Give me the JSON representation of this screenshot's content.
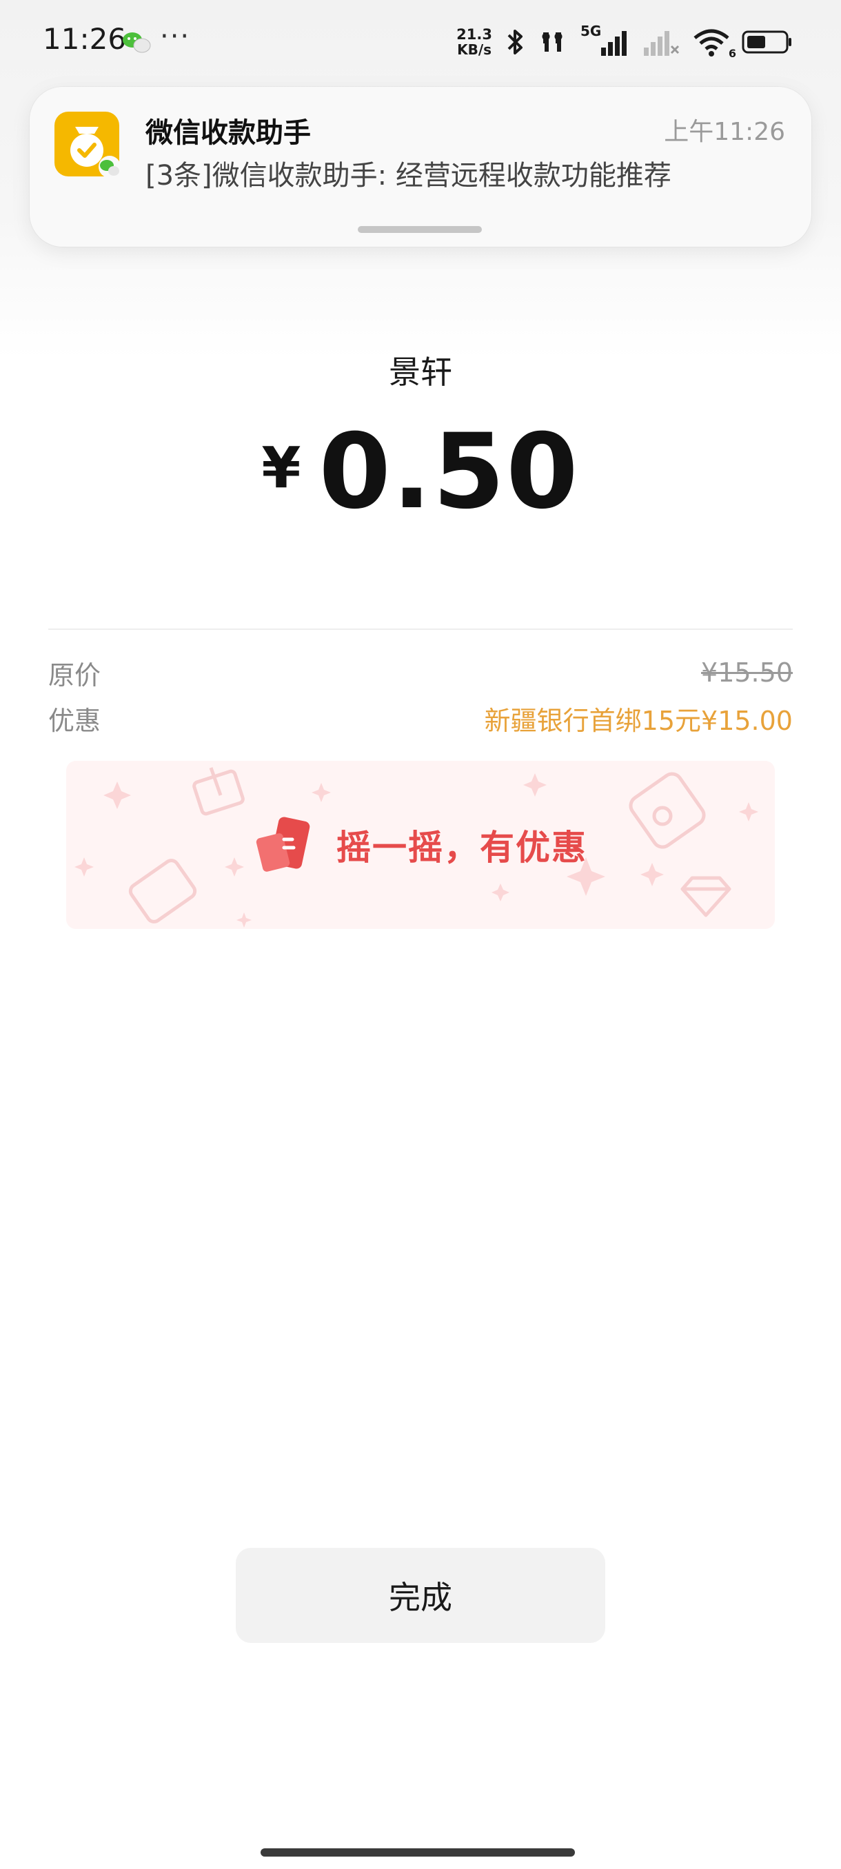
{
  "status_bar": {
    "time": "11:26",
    "more": "···",
    "net_speed_value": "21.3",
    "net_speed_unit": "KB/s",
    "signal_label": "5G",
    "wifi_sub": "6"
  },
  "notification": {
    "app_name": "微信收款助手",
    "time": "上午11:26",
    "body": "[3条]微信收款助手: 经营远程收款功能推荐",
    "app_icon": "wechat-pay-assistant-icon"
  },
  "payment": {
    "merchant": "景轩",
    "currency_symbol": "¥",
    "amount": "0.50",
    "original_label": "原价",
    "original_value": "¥15.50",
    "discount_label": "优惠",
    "discount_value": "新疆银行首绑15元¥15.00"
  },
  "promo": {
    "text": "摇一摇，有优惠",
    "icon": "shake-phone-icon"
  },
  "done_label": "完成",
  "colors": {
    "discount": "#e8a23a",
    "promo_text": "#e64b4b",
    "promo_bg": "#fff4f4",
    "app_icon_bg": "#f5b800",
    "wechat_green": "#4cbf3b"
  }
}
